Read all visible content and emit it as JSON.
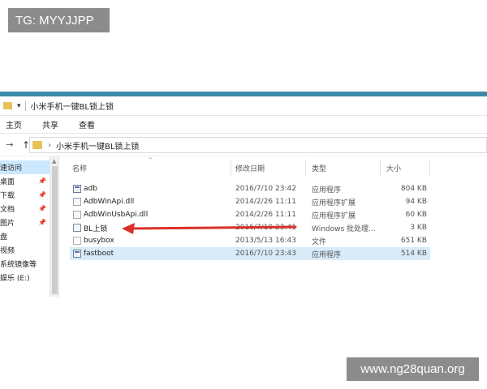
{
  "watermarks": {
    "top": "TG: MYYJJPP",
    "bottom": "www.ng28quan.org"
  },
  "window": {
    "title": "小米手机一键BL锁上锁",
    "qa_arrow": "▾",
    "accent_color": "#3d8ba9"
  },
  "ribbon": {
    "tabs": [
      "主页",
      "共享",
      "查看"
    ]
  },
  "address": {
    "back": "←",
    "forward": "→",
    "up": "↑",
    "chevron": "›",
    "path": "小米手机一键BL锁上锁"
  },
  "nav_pane": {
    "items": [
      {
        "label": "速访问",
        "pinned": false,
        "selected": true
      },
      {
        "label": "桌面",
        "pinned": true,
        "selected": false
      },
      {
        "label": "下载",
        "pinned": true,
        "selected": false
      },
      {
        "label": "文档",
        "pinned": true,
        "selected": false
      },
      {
        "label": "图片",
        "pinned": true,
        "selected": false
      },
      {
        "label": "盘",
        "pinned": false,
        "selected": false
      },
      {
        "label": "视频",
        "pinned": false,
        "selected": false
      },
      {
        "label": "系统镜像等",
        "pinned": false,
        "selected": false
      },
      {
        "label": "娱乐 (E:)",
        "pinned": false,
        "selected": false
      }
    ],
    "pin_glyph": "📌"
  },
  "file_list": {
    "columns": [
      "名称",
      "修改日期",
      "类型",
      "大小"
    ],
    "sort_indicator": "^",
    "files": [
      {
        "name": "adb",
        "date": "2016/7/10 23:42",
        "type": "应用程序",
        "size": "804 KB",
        "icon": "exe-icon",
        "selected": false
      },
      {
        "name": "AdbWinApi.dll",
        "date": "2014/2/26 11:11",
        "type": "应用程序扩展",
        "size": "94 KB",
        "icon": "dll-icon",
        "selected": false
      },
      {
        "name": "AdbWinUsbApi.dll",
        "date": "2014/2/26 11:11",
        "type": "应用程序扩展",
        "size": "60 KB",
        "icon": "dll-icon",
        "selected": false
      },
      {
        "name": "BL上锁",
        "date": "2016/7/10 23:41",
        "type": "Windows 批处理...",
        "size": "3 KB",
        "icon": "bat-icon",
        "selected": false
      },
      {
        "name": "busybox",
        "date": "2013/5/13 16:43",
        "type": "文件",
        "size": "651 KB",
        "icon": "file-icon",
        "selected": false
      },
      {
        "name": "fastboot",
        "date": "2016/7/10 23:43",
        "type": "应用程序",
        "size": "514 KB",
        "icon": "exe-icon",
        "selected": true
      }
    ]
  },
  "annotation": {
    "arrow_color": "#d9302b"
  }
}
